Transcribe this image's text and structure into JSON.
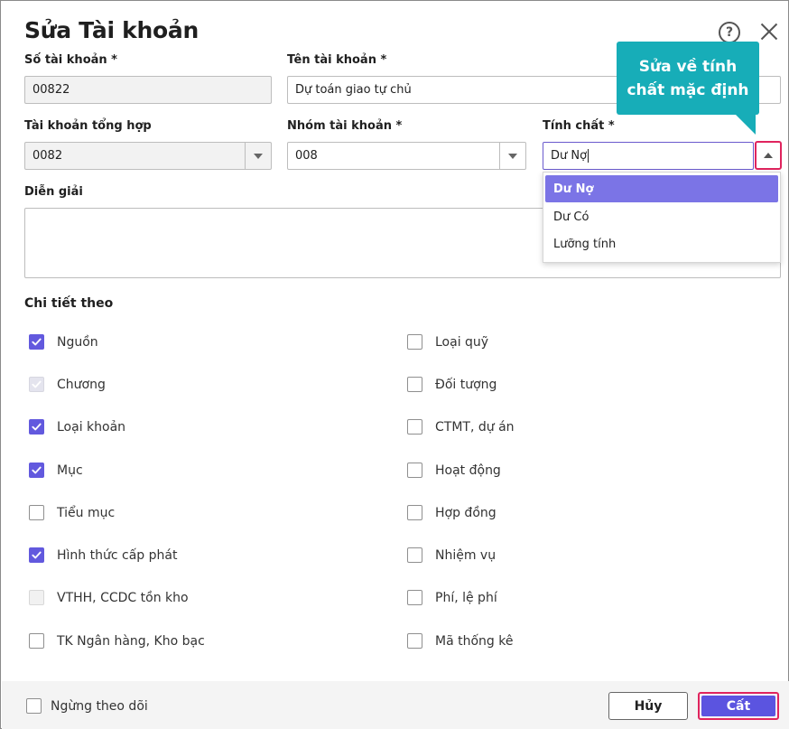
{
  "dialog": {
    "title": "Sửa Tài khoản",
    "help_icon_glyph": "?"
  },
  "fields": {
    "so_tai_khoan": {
      "label": "Số tài khoản *",
      "value": "00822"
    },
    "ten_tai_khoan": {
      "label": "Tên tài khoản *",
      "value": "Dự toán giao tự chủ"
    },
    "tai_khoan_tong_hop": {
      "label": "Tài khoản tổng hợp",
      "value": "0082"
    },
    "nhom_tai_khoan": {
      "label": "Nhóm tài khoản *",
      "value": "008"
    },
    "tinh_chat": {
      "label": "Tính chất *",
      "value": "Dư Nợ"
    },
    "dien_giai": {
      "label": "Diễn giải",
      "value": ""
    }
  },
  "dropdown": {
    "options": [
      "Dư Nợ",
      "Dư Có",
      "Lưỡng tính"
    ],
    "selected": "Dư Nợ"
  },
  "callout": {
    "line1": "Sửa về tính",
    "line2": "chất mặc định",
    "color": "#17adb8"
  },
  "details": {
    "title": "Chi tiết theo",
    "left": [
      {
        "label": "Nguồn",
        "state": "checked"
      },
      {
        "label": "Chương",
        "state": "checked-disabled"
      },
      {
        "label": "Loại khoản",
        "state": "checked"
      },
      {
        "label": "Mục",
        "state": "checked"
      },
      {
        "label": "Tiểu mục",
        "state": "unchecked"
      },
      {
        "label": "Hình thức cấp phát",
        "state": "checked"
      },
      {
        "label": "VTHH, CCDC tồn kho",
        "state": "disabled"
      },
      {
        "label": "TK Ngân hàng, Kho bạc",
        "state": "unchecked"
      }
    ],
    "right": [
      {
        "label": "Loại quỹ",
        "state": "unchecked"
      },
      {
        "label": "Đối tượng",
        "state": "unchecked"
      },
      {
        "label": "CTMT, dự án",
        "state": "unchecked"
      },
      {
        "label": "Hoạt động",
        "state": "unchecked"
      },
      {
        "label": "Hợp đồng",
        "state": "unchecked"
      },
      {
        "label": "Nhiệm vụ",
        "state": "unchecked"
      },
      {
        "label": "Phí, lệ phí",
        "state": "unchecked"
      },
      {
        "label": "Mã thống kê",
        "state": "unchecked"
      }
    ]
  },
  "footer": {
    "stop_tracking_label": "Ngừng theo dõi",
    "stop_tracking_checked": false,
    "cancel_label": "Hủy",
    "save_label": "Cất"
  },
  "colors": {
    "accent": "#5b54e0",
    "highlight_border": "#e0245e",
    "dropdown_selected": "#7b74e6"
  }
}
